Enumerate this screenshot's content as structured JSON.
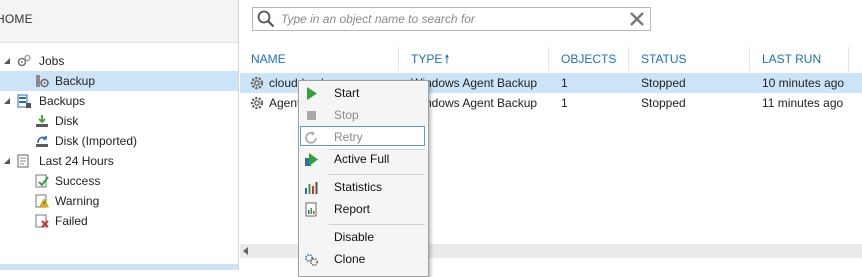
{
  "nav": {
    "home_label": "HOME",
    "tree": [
      {
        "id": "jobs",
        "label": "Jobs",
        "icon": "gears-icon",
        "expander": "◢"
      },
      {
        "id": "backup",
        "label": "Backup",
        "icon": "backup-job-icon",
        "selected": true
      },
      {
        "id": "backups",
        "label": "Backups",
        "icon": "backups-icon",
        "expander": "◢"
      },
      {
        "id": "disk",
        "label": "Disk",
        "icon": "disk-icon"
      },
      {
        "id": "disk_imported",
        "label": "Disk (Imported)",
        "icon": "disk-imported-icon"
      },
      {
        "id": "last24",
        "label": "Last 24 Hours",
        "icon": "history-icon",
        "expander": "◢"
      },
      {
        "id": "success",
        "label": "Success",
        "icon": "success-icon"
      },
      {
        "id": "warning",
        "label": "Warning",
        "icon": "warning-icon"
      },
      {
        "id": "failed",
        "label": "Failed",
        "icon": "failed-icon"
      }
    ]
  },
  "search": {
    "placeholder": "Type in an object name to search for"
  },
  "table": {
    "columns": {
      "name": "NAME",
      "type": "TYPE",
      "sort_arrow": "🠕",
      "objects": "OBJECTS",
      "status": "STATUS",
      "last_run": "LAST RUN"
    },
    "rows": [
      {
        "name": "cloud-backup",
        "type": "Windows Agent Backup",
        "objects": "1",
        "status": "Stopped",
        "last_run": "10 minutes ago",
        "selected": true
      },
      {
        "name": "Agent",
        "type": "Windows Agent Backup",
        "objects": "1",
        "status": "Stopped",
        "last_run": "11 minutes ago",
        "selected": false
      }
    ]
  },
  "context_menu": {
    "items": [
      {
        "label": "Start",
        "icon": "play-icon",
        "enabled": true
      },
      {
        "label": "Stop",
        "icon": "stop-icon",
        "enabled": false
      },
      {
        "label": "Retry",
        "icon": "retry-icon",
        "enabled": false,
        "hovered": true
      },
      {
        "label": "Active Full",
        "icon": "active-full-icon",
        "enabled": true
      },
      {
        "label": "Statistics",
        "icon": "statistics-icon",
        "enabled": true
      },
      {
        "label": "Report",
        "icon": "report-icon",
        "enabled": true
      },
      {
        "label": "Disable",
        "icon": "",
        "enabled": true
      },
      {
        "label": "Clone",
        "icon": "clone-icon",
        "enabled": true
      }
    ]
  },
  "colors": {
    "selection": "#cce4f7",
    "header_text": "#1e6fb8",
    "play_green": "#2fa336"
  }
}
